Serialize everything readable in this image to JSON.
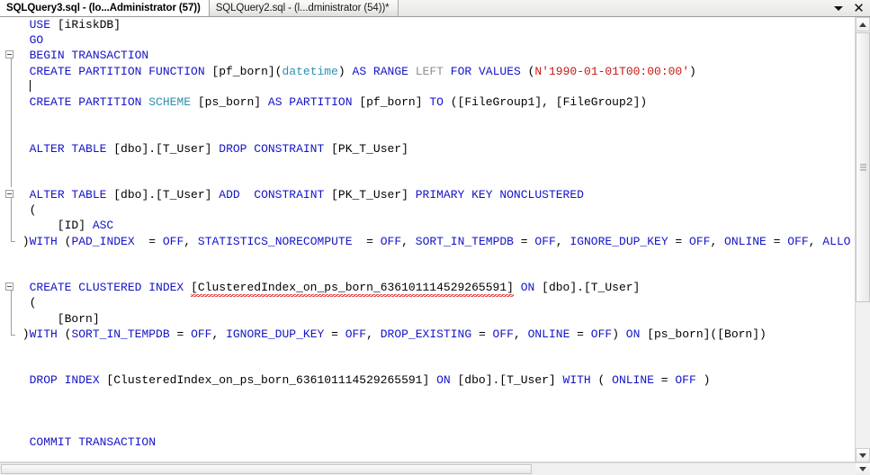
{
  "window": {
    "app": "SQL Server Management Studio Query Editor"
  },
  "tabs": {
    "items": [
      {
        "label": "SQLQuery3.sql - (lo...Administrator (57))",
        "active": true,
        "modified": false
      },
      {
        "label": "SQLQuery2.sql - (l...dministrator (54))*",
        "active": false,
        "modified": true
      }
    ],
    "menu_icon": "chevron-down-icon",
    "close_icon": "close-icon"
  },
  "editor": {
    "lines": [
      {
        "n": 1,
        "fold": "none",
        "segments": [
          {
            "t": "  ",
            "c": "punc"
          },
          {
            "t": "USE",
            "c": "kw"
          },
          {
            "t": " [iRiskDB]",
            "c": "id"
          }
        ]
      },
      {
        "n": 2,
        "fold": "none",
        "segments": [
          {
            "t": "  ",
            "c": "punc"
          },
          {
            "t": "GO",
            "c": "kw"
          }
        ]
      },
      {
        "n": 3,
        "fold": "start",
        "segments": [
          {
            "t": "  ",
            "c": "punc"
          },
          {
            "t": "BEGIN TRANSACTION",
            "c": "kw"
          }
        ]
      },
      {
        "n": 4,
        "fold": "bar",
        "segments": [
          {
            "t": "  ",
            "c": "punc"
          },
          {
            "t": "CREATE PARTITION FUNCTION",
            "c": "kw"
          },
          {
            "t": " [pf_born](",
            "c": "id"
          },
          {
            "t": "datetime",
            "c": "kw2"
          },
          {
            "t": ") ",
            "c": "id"
          },
          {
            "t": "AS RANGE",
            "c": "kw"
          },
          {
            "t": " ",
            "c": "id"
          },
          {
            "t": "LEFT",
            "c": "gray"
          },
          {
            "t": " ",
            "c": "id"
          },
          {
            "t": "FOR VALUES",
            "c": "kw"
          },
          {
            "t": " (",
            "c": "id"
          },
          {
            "t": "N'1990-01-01T00:00:00'",
            "c": "str"
          },
          {
            "t": ")",
            "c": "id"
          }
        ]
      },
      {
        "n": 5,
        "fold": "bar",
        "caret": true,
        "segments": []
      },
      {
        "n": 6,
        "fold": "bar",
        "segments": [
          {
            "t": "  ",
            "c": "punc"
          },
          {
            "t": "CREATE PARTITION",
            "c": "kw"
          },
          {
            "t": " ",
            "c": "id"
          },
          {
            "t": "SCHEME",
            "c": "kw2"
          },
          {
            "t": " [ps_born] ",
            "c": "id"
          },
          {
            "t": "AS PARTITION",
            "c": "kw"
          },
          {
            "t": " [pf_born] ",
            "c": "id"
          },
          {
            "t": "TO",
            "c": "kw"
          },
          {
            "t": " ([FileGroup1], [FileGroup2])",
            "c": "id"
          }
        ]
      },
      {
        "n": 7,
        "fold": "bar",
        "segments": []
      },
      {
        "n": 8,
        "fold": "bar",
        "segments": []
      },
      {
        "n": 9,
        "fold": "bar",
        "segments": [
          {
            "t": "  ",
            "c": "punc"
          },
          {
            "t": "ALTER TABLE",
            "c": "kw"
          },
          {
            "t": " [dbo].[T_User] ",
            "c": "id"
          },
          {
            "t": "DROP CONSTRAINT",
            "c": "kw"
          },
          {
            "t": " [PK_T_User]",
            "c": "id"
          }
        ]
      },
      {
        "n": 10,
        "fold": "bar",
        "segments": []
      },
      {
        "n": 11,
        "fold": "bar",
        "segments": []
      },
      {
        "n": 12,
        "fold": "start",
        "segments": [
          {
            "t": "  ",
            "c": "punc"
          },
          {
            "t": "ALTER TABLE",
            "c": "kw"
          },
          {
            "t": " [dbo].[T_User] ",
            "c": "id"
          },
          {
            "t": "ADD",
            "c": "kw"
          },
          {
            "t": "  ",
            "c": "id"
          },
          {
            "t": "CONSTRAINT",
            "c": "kw"
          },
          {
            "t": " [PK_T_User] ",
            "c": "id"
          },
          {
            "t": "PRIMARY KEY NONCLUSTERED",
            "c": "kw"
          }
        ]
      },
      {
        "n": 13,
        "fold": "bar",
        "segments": [
          {
            "t": "  (",
            "c": "id"
          }
        ]
      },
      {
        "n": 14,
        "fold": "bar",
        "segments": [
          {
            "t": "      [ID] ",
            "c": "id"
          },
          {
            "t": "ASC",
            "c": "kw"
          }
        ]
      },
      {
        "n": 15,
        "fold": "end",
        "segments": [
          {
            "t": " )",
            "c": "id"
          },
          {
            "t": "WITH",
            "c": "kw"
          },
          {
            "t": " (",
            "c": "id"
          },
          {
            "t": "PAD_INDEX",
            "c": "kw"
          },
          {
            "t": "  = ",
            "c": "id"
          },
          {
            "t": "OFF",
            "c": "kw"
          },
          {
            "t": ", ",
            "c": "id"
          },
          {
            "t": "STATISTICS_NORECOMPUTE",
            "c": "kw"
          },
          {
            "t": "  = ",
            "c": "id"
          },
          {
            "t": "OFF",
            "c": "kw"
          },
          {
            "t": ", ",
            "c": "id"
          },
          {
            "t": "SORT_IN_TEMPDB",
            "c": "kw"
          },
          {
            "t": " = ",
            "c": "id"
          },
          {
            "t": "OFF",
            "c": "kw"
          },
          {
            "t": ", ",
            "c": "id"
          },
          {
            "t": "IGNORE_DUP_KEY",
            "c": "kw"
          },
          {
            "t": " = ",
            "c": "id"
          },
          {
            "t": "OFF",
            "c": "kw"
          },
          {
            "t": ", ",
            "c": "id"
          },
          {
            "t": "ONLINE",
            "c": "kw"
          },
          {
            "t": " = ",
            "c": "id"
          },
          {
            "t": "OFF",
            "c": "kw"
          },
          {
            "t": ", ",
            "c": "id"
          },
          {
            "t": "ALLO",
            "c": "kw"
          }
        ]
      },
      {
        "n": 16,
        "fold": "none",
        "segments": []
      },
      {
        "n": 17,
        "fold": "none",
        "segments": []
      },
      {
        "n": 18,
        "fold": "start",
        "segments": [
          {
            "t": "  ",
            "c": "punc"
          },
          {
            "t": "CREATE CLUSTERED INDEX",
            "c": "kw"
          },
          {
            "t": " ",
            "c": "id"
          },
          {
            "t": "[ClusteredIndex_on_ps_born_636101114529265591]",
            "c": "id",
            "squiggle": true
          },
          {
            "t": " ",
            "c": "id"
          },
          {
            "t": "ON",
            "c": "kw"
          },
          {
            "t": " [dbo].[T_User]",
            "c": "id"
          }
        ]
      },
      {
        "n": 19,
        "fold": "bar",
        "segments": [
          {
            "t": "  (",
            "c": "id"
          }
        ]
      },
      {
        "n": 20,
        "fold": "bar",
        "segments": [
          {
            "t": "      [Born]",
            "c": "id"
          }
        ]
      },
      {
        "n": 21,
        "fold": "end",
        "segments": [
          {
            "t": " )",
            "c": "id"
          },
          {
            "t": "WITH",
            "c": "kw"
          },
          {
            "t": " (",
            "c": "id"
          },
          {
            "t": "SORT_IN_TEMPDB",
            "c": "kw"
          },
          {
            "t": " = ",
            "c": "id"
          },
          {
            "t": "OFF",
            "c": "kw"
          },
          {
            "t": ", ",
            "c": "id"
          },
          {
            "t": "IGNORE_DUP_KEY",
            "c": "kw"
          },
          {
            "t": " = ",
            "c": "id"
          },
          {
            "t": "OFF",
            "c": "kw"
          },
          {
            "t": ", ",
            "c": "id"
          },
          {
            "t": "DROP_EXISTING",
            "c": "kw"
          },
          {
            "t": " = ",
            "c": "id"
          },
          {
            "t": "OFF",
            "c": "kw"
          },
          {
            "t": ", ",
            "c": "id"
          },
          {
            "t": "ONLINE",
            "c": "kw"
          },
          {
            "t": " = ",
            "c": "id"
          },
          {
            "t": "OFF",
            "c": "kw"
          },
          {
            "t": ") ",
            "c": "id"
          },
          {
            "t": "ON",
            "c": "kw"
          },
          {
            "t": " [ps_born]([Born])",
            "c": "id"
          }
        ]
      },
      {
        "n": 22,
        "fold": "none",
        "segments": []
      },
      {
        "n": 23,
        "fold": "none",
        "segments": []
      },
      {
        "n": 24,
        "fold": "none",
        "segments": [
          {
            "t": "  ",
            "c": "punc"
          },
          {
            "t": "DROP INDEX",
            "c": "kw"
          },
          {
            "t": " [ClusteredIndex_on_ps_born_636101114529265591] ",
            "c": "id"
          },
          {
            "t": "ON",
            "c": "kw"
          },
          {
            "t": " [dbo].[T_User] ",
            "c": "id"
          },
          {
            "t": "WITH",
            "c": "kw"
          },
          {
            "t": " ( ",
            "c": "id"
          },
          {
            "t": "ONLINE",
            "c": "kw"
          },
          {
            "t": " = ",
            "c": "id"
          },
          {
            "t": "OFF",
            "c": "kw"
          },
          {
            "t": " )",
            "c": "id"
          }
        ]
      },
      {
        "n": 25,
        "fold": "none",
        "segments": []
      },
      {
        "n": 26,
        "fold": "none",
        "segments": []
      },
      {
        "n": 27,
        "fold": "none",
        "segments": []
      },
      {
        "n": 28,
        "fold": "none",
        "segments": [
          {
            "t": "  ",
            "c": "punc"
          },
          {
            "t": "COMMIT TRANSACTION",
            "c": "kw"
          }
        ]
      }
    ]
  },
  "colors": {
    "keyword": "#1414c8",
    "keyword_secondary": "#2b91af",
    "keyword_gray": "#8f8f8f",
    "string": "#c41a16",
    "identifier": "#000000",
    "error_squiggle": "#e01b1b",
    "editor_background": "#ffffff"
  },
  "scrollbars": {
    "vertical": {
      "up_icon": "arrow-up-icon",
      "down_icon": "arrow-down-icon"
    },
    "horizontal": {
      "right_icon": "arrow-right-icon"
    }
  }
}
